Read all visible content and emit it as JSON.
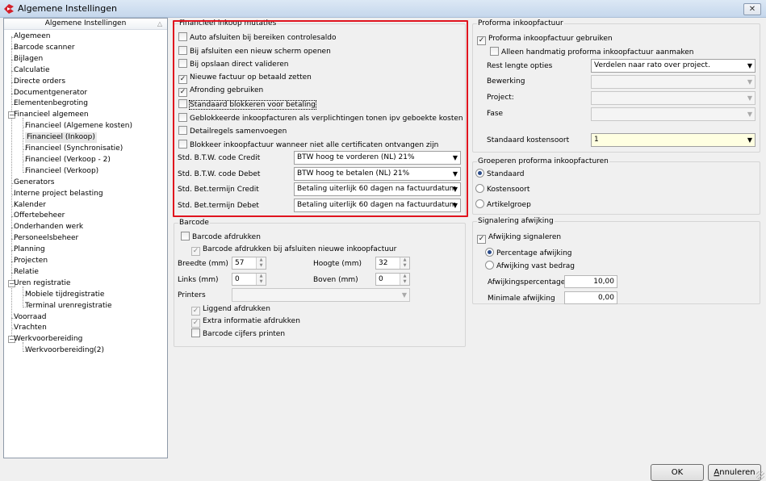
{
  "window": {
    "title": "Algemene Instellingen",
    "close_glyph": "✕"
  },
  "tree": {
    "header": "Algemene Instellingen",
    "items": [
      {
        "label": "Algemeen"
      },
      {
        "label": "Barcode scanner"
      },
      {
        "label": "Bijlagen"
      },
      {
        "label": "Calculatie"
      },
      {
        "label": "Directe orders"
      },
      {
        "label": "Documentgenerator"
      },
      {
        "label": "Elementenbegroting"
      },
      {
        "label": "Financieel algemeen"
      },
      {
        "label": "Financieel (Algemene kosten)"
      },
      {
        "label": "Financieel (Inkoop)"
      },
      {
        "label": "Financieel (Synchronisatie)"
      },
      {
        "label": "Financieel (Verkoop - 2)"
      },
      {
        "label": "Financieel (Verkoop)"
      },
      {
        "label": "Generators"
      },
      {
        "label": "Interne project belasting"
      },
      {
        "label": "Kalender"
      },
      {
        "label": "Offertebeheer"
      },
      {
        "label": "Onderhanden werk"
      },
      {
        "label": "Personeelsbeheer"
      },
      {
        "label": "Planning"
      },
      {
        "label": "Projecten"
      },
      {
        "label": "Relatie"
      },
      {
        "label": "Uren registratie"
      },
      {
        "label": "Mobiele tijdregistratie"
      },
      {
        "label": "Terminal urenregistratie"
      },
      {
        "label": "Voorraad"
      },
      {
        "label": "Vrachten"
      },
      {
        "label": "Werkvoorbereiding"
      },
      {
        "label": "Werkvoorbereiding(2)"
      }
    ]
  },
  "fin": {
    "title": "Financieel inkoop mutaties",
    "checks": [
      {
        "label": "Auto afsluiten bij bereiken controlesaldo",
        "mark": ""
      },
      {
        "label": "Bij afsluiten een nieuw scherm openen",
        "mark": ""
      },
      {
        "label": "Bij opslaan direct valideren",
        "mark": ""
      },
      {
        "label": "Nieuwe factuur op betaald zetten",
        "mark": "✓"
      },
      {
        "label": "Afronding gebruiken",
        "mark": "✓"
      },
      {
        "label": "Standaard blokkeren voor betaling",
        "mark": ""
      },
      {
        "label": "Geblokkeerde inkoopfacturen als verplichtingen tonen ipv geboekte kosten",
        "mark": ""
      },
      {
        "label": "Detailregels samenvoegen",
        "mark": ""
      },
      {
        "label": "Blokkeer inkoopfactuur wanneer niet alle certificaten ontvangen zijn",
        "mark": ""
      }
    ],
    "fields": [
      {
        "label": "Std. B.T.W. code Credit",
        "value": "BTW hoog te vorderen (NL) 21%"
      },
      {
        "label": "Std. B.T.W. code Debet",
        "value": "BTW hoog te betalen (NL) 21%"
      },
      {
        "label": "Std. Bet.termijn Credit",
        "value": "Betaling uiterlijk 60 dagen na factuurdatum"
      },
      {
        "label": "Std. Bet.termijn Debet",
        "value": "Betaling uiterlijk 60 dagen na factuurdatum"
      }
    ]
  },
  "barcode": {
    "title": "Barcode",
    "afdrukken": {
      "label": "Barcode afdrukken",
      "mark": ""
    },
    "afdrukken_afsluiten": {
      "label": "Barcode afdrukken bij afsluiten nieuwe inkoopfactuur",
      "mark": "✓"
    },
    "breedte": {
      "label": "Breedte (mm)",
      "value": "57"
    },
    "hoogte": {
      "label": "Hoogte (mm)",
      "value": "32"
    },
    "links": {
      "label": "Links (mm)",
      "value": "0"
    },
    "boven": {
      "label": "Boven (mm)",
      "value": "0"
    },
    "printers": {
      "label": "Printers",
      "value": ""
    },
    "liggend": {
      "label": "Liggend afdrukken",
      "mark": "✓"
    },
    "extra": {
      "label": "Extra informatie afdrukken",
      "mark": "✓"
    },
    "cijfers": {
      "label": "Barcode cijfers printen",
      "mark": ""
    }
  },
  "proforma": {
    "title": "Proforma inkoopfactuur",
    "gebruiken": {
      "label": "Proforma inkoopfactuur gebruiken",
      "mark": "✓"
    },
    "handmatig": {
      "label": "Alleen handmatig proforma inkoopfactuur aanmaken",
      "mark": ""
    },
    "rest": {
      "label": "Rest lengte opties",
      "value": "Verdelen naar rato over project."
    },
    "bewerking": {
      "label": "Bewerking",
      "value": ""
    },
    "project": {
      "label": "Project:",
      "value": ""
    },
    "fase": {
      "label": "Fase",
      "value": ""
    },
    "kostensoort": {
      "label": "Standaard kostensoort",
      "value": "1"
    }
  },
  "groeperen": {
    "title": "Groeperen proforma inkoopfacturen",
    "options": [
      "Standaard",
      "Kostensoort",
      "Artikelgroep"
    ]
  },
  "signalering": {
    "title": "Signalering afwijking",
    "check": {
      "label": "Afwijking signaleren",
      "mark": "✓"
    },
    "percentage": "Percentage afwijking",
    "vast": "Afwijking vast bedrag",
    "perc_field": {
      "label": "Afwijkingspercentage",
      "value": "10,00"
    },
    "min_field": {
      "label": "Minimale afwijking",
      "value": "0,00"
    }
  },
  "buttons": {
    "ok": "OK",
    "cancel_u": "A",
    "cancel_rest": "nnuleren"
  }
}
